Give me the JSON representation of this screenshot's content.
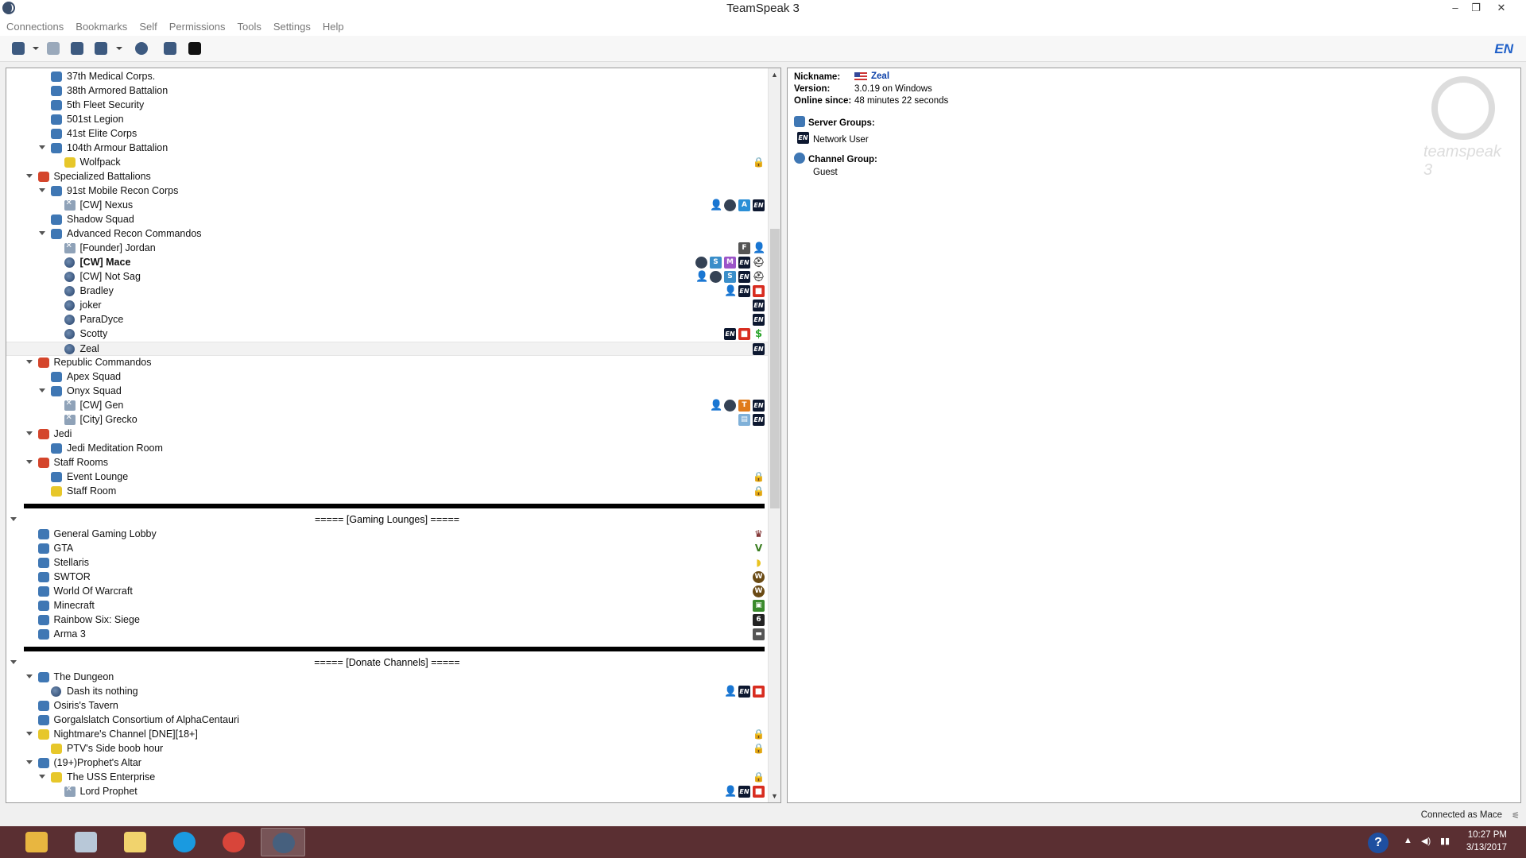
{
  "window": {
    "title": "TeamSpeak 3",
    "minimize": "–",
    "restore": "❐",
    "close": "✕"
  },
  "menu": [
    "Connections",
    "Bookmarks",
    "Self",
    "Permissions",
    "Tools",
    "Settings",
    "Help"
  ],
  "toolbar": {
    "lang": "EN"
  },
  "tree": [
    {
      "label": "37th Medical Corps.",
      "indent": 3,
      "icon": "ch-blue",
      "badges": []
    },
    {
      "label": "38th Armored Battalion",
      "indent": 3,
      "icon": "ch-blue",
      "badges": []
    },
    {
      "label": "5th Fleet Security",
      "indent": 3,
      "icon": "ch-blue",
      "badges": []
    },
    {
      "label": "501st Legion",
      "indent": 3,
      "icon": "ch-blue",
      "badges": []
    },
    {
      "label": "41st Elite Corps",
      "indent": 3,
      "icon": "ch-blue",
      "badges": []
    },
    {
      "label": "104th Armour Battalion",
      "indent": 3,
      "icon": "ch-blue",
      "expand": true,
      "badges": []
    },
    {
      "label": "Wolfpack",
      "indent": 4,
      "icon": "ch-yellow",
      "badges": [
        "lock"
      ]
    },
    {
      "label": "Specialized Battalions",
      "indent": 2,
      "icon": "ch-red",
      "expand": true,
      "badges": []
    },
    {
      "label": "91st Mobile Recon Corps",
      "indent": 3,
      "icon": "ch-blue",
      "expand": true,
      "badges": []
    },
    {
      "label": "[CW] Nexus",
      "indent": 4,
      "icon": "user-away",
      "badges": [
        "user",
        "dot",
        "A",
        "en"
      ]
    },
    {
      "label": "Shadow Squad",
      "indent": 3,
      "icon": "ch-blue",
      "badges": []
    },
    {
      "label": "Advanced Recon Commandos",
      "indent": 3,
      "icon": "ch-blue",
      "expand": true,
      "badges": []
    },
    {
      "label": "[Founder] Jordan",
      "indent": 4,
      "icon": "user-away",
      "badges": [
        "F",
        "user"
      ]
    },
    {
      "label": "[CW] Mace",
      "indent": 4,
      "icon": "user-idle",
      "bold": true,
      "badges": [
        "dot",
        "S",
        "M",
        "en",
        "helm"
      ]
    },
    {
      "label": "[CW] Not Sag",
      "indent": 4,
      "icon": "user-idle",
      "badges": [
        "user",
        "dot",
        "S",
        "en",
        "helm"
      ]
    },
    {
      "label": "Bradley",
      "indent": 4,
      "icon": "user-idle",
      "badges": [
        "user",
        "en",
        "gift"
      ]
    },
    {
      "label": "joker",
      "indent": 4,
      "icon": "user-idle",
      "badges": [
        "en"
      ]
    },
    {
      "label": "ParaDyce",
      "indent": 4,
      "icon": "user-idle",
      "badges": [
        "en"
      ]
    },
    {
      "label": "Scotty",
      "indent": 4,
      "icon": "user-idle",
      "badges": [
        "en",
        "gift",
        "dollar"
      ]
    },
    {
      "label": "Zeal",
      "indent": 4,
      "icon": "user-idle",
      "selected": true,
      "badges": [
        "en"
      ]
    },
    {
      "label": "Republic Commandos",
      "indent": 2,
      "icon": "ch-red",
      "expand": true,
      "badges": []
    },
    {
      "label": "Apex Squad",
      "indent": 3,
      "icon": "ch-blue",
      "badges": []
    },
    {
      "label": "Onyx Squad",
      "indent": 3,
      "icon": "ch-blue",
      "expand": true,
      "badges": []
    },
    {
      "label": "[CW] Gen",
      "indent": 4,
      "icon": "user-away",
      "badges": [
        "user",
        "dot",
        "T",
        "en"
      ]
    },
    {
      "label": "[City] Grecko",
      "indent": 4,
      "icon": "user-away",
      "badges": [
        "card",
        "en"
      ]
    },
    {
      "label": "Jedi",
      "indent": 2,
      "icon": "ch-red",
      "expand": true,
      "badges": []
    },
    {
      "label": "Jedi Meditation Room",
      "indent": 3,
      "icon": "ch-blue",
      "badges": []
    },
    {
      "label": "Staff Rooms",
      "indent": 2,
      "icon": "ch-red",
      "expand": true,
      "badges": []
    },
    {
      "label": "Event Lounge",
      "indent": 3,
      "icon": "ch-blue",
      "badges": [
        "lock"
      ]
    },
    {
      "label": "Staff Room",
      "indent": 3,
      "icon": "ch-yellow",
      "badges": [
        "lock"
      ]
    },
    {
      "spacer": "bar"
    },
    {
      "spacer": "label",
      "label": "===== [Gaming Lounges] =====",
      "expand": true
    },
    {
      "label": "General Gaming Lobby",
      "indent": 2,
      "icon": "ch-blue",
      "badges": [
        "crown"
      ]
    },
    {
      "label": "GTA",
      "indent": 2,
      "icon": "ch-blue",
      "badges": [
        "v"
      ]
    },
    {
      "label": "Stellaris",
      "indent": 2,
      "icon": "ch-blue",
      "badges": [
        "yel"
      ]
    },
    {
      "label": "SWTOR",
      "indent": 2,
      "icon": "ch-blue",
      "badges": [
        "wow"
      ]
    },
    {
      "label": "World Of Warcraft",
      "indent": 2,
      "icon": "ch-blue",
      "badges": [
        "wow"
      ]
    },
    {
      "label": "Minecraft",
      "indent": 2,
      "icon": "ch-blue",
      "badges": [
        "creep"
      ]
    },
    {
      "label": "Rainbow Six: Siege",
      "indent": 2,
      "icon": "ch-blue",
      "badges": [
        "r6"
      ]
    },
    {
      "label": "Arma 3",
      "indent": 2,
      "icon": "ch-blue",
      "badges": [
        "arma"
      ]
    },
    {
      "spacer": "bar"
    },
    {
      "spacer": "label",
      "label": "===== [Donate Channels] =====",
      "expand": true
    },
    {
      "label": "The Dungeon",
      "indent": 2,
      "icon": "ch-blue",
      "expand": true,
      "badges": []
    },
    {
      "label": "Dash its nothing",
      "indent": 3,
      "icon": "user-idle",
      "badges": [
        "user",
        "en",
        "gift"
      ]
    },
    {
      "label": "Osiris's Tavern",
      "indent": 2,
      "icon": "ch-blue",
      "badges": []
    },
    {
      "label": "Gorgalslatch Consortium of AlphaCentauri",
      "indent": 2,
      "icon": "ch-blue",
      "badges": []
    },
    {
      "label": "Nightmare's Channel [DNE][18+]",
      "indent": 2,
      "icon": "ch-yellow",
      "expand": true,
      "badges": [
        "lock"
      ]
    },
    {
      "label": "PTV's Side boob hour",
      "indent": 3,
      "icon": "ch-yellow",
      "badges": [
        "lock"
      ]
    },
    {
      "label": "(19+)Prophet's Altar",
      "indent": 2,
      "icon": "ch-blue",
      "expand": true,
      "badges": []
    },
    {
      "label": "The USS Enterprise",
      "indent": 3,
      "icon": "ch-yellow",
      "expand": true,
      "badges": [
        "lock"
      ]
    },
    {
      "label": "Lord Prophet",
      "indent": 4,
      "icon": "user-away",
      "badges": [
        "user",
        "en",
        "gift"
      ]
    }
  ],
  "badge_glyphs": {
    "lock": "🔒",
    "en": "EN",
    "A": "A",
    "S": "S",
    "M": "M",
    "T": "T",
    "F": "F",
    "dot": "●",
    "user": "👤",
    "gift": "■",
    "dollar": "$",
    "helm": "⛑",
    "crown": "♛",
    "v": "V",
    "yel": "◗",
    "wow": "W",
    "creep": "▣",
    "r6": "6",
    "arma": "▬",
    "card": "▤"
  },
  "info": {
    "nickname_label": "Nickname:",
    "nickname": "Zeal",
    "version_label": "Version:",
    "version": "3.0.19 on Windows",
    "online_label": "Online since:",
    "online": "48 minutes 22 seconds",
    "server_groups_label": "Server Groups:",
    "server_group": "Network User",
    "channel_group_label": "Channel Group:",
    "channel_group": "Guest",
    "watermark": "teamspeak 3"
  },
  "status": {
    "text": "Connected as Mace"
  },
  "taskbar": {
    "apps": [
      {
        "name": "file-explorer",
        "color": "#e8b640"
      },
      {
        "name": "network-app",
        "color": "#b8c8d8"
      },
      {
        "name": "folder",
        "color": "#f1d36d"
      },
      {
        "name": "skype",
        "color": "#1a9ae0"
      },
      {
        "name": "chrome",
        "color": "#d8453a"
      },
      {
        "name": "teamspeak",
        "color": "#46607e",
        "active": true
      }
    ],
    "time": "10:27 PM",
    "date": "3/13/2017"
  }
}
